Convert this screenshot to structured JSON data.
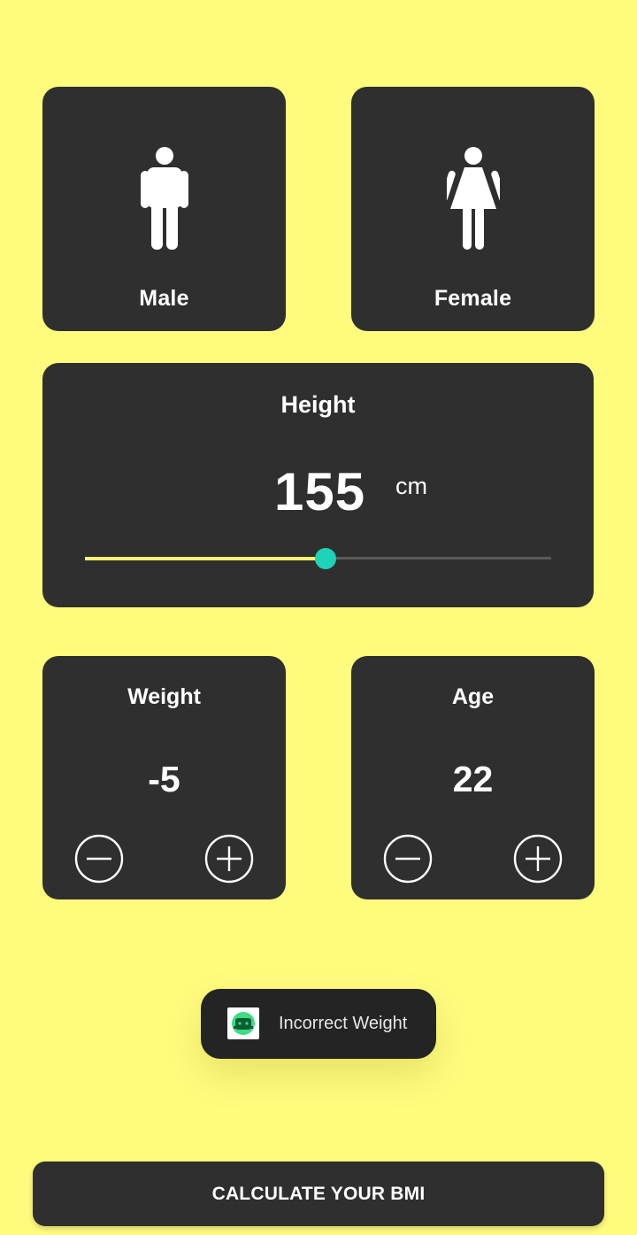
{
  "colors": {
    "background": "#FFFB7D",
    "card": "#2F2F2F",
    "slider_active": "#FFF176",
    "slider_thumb": "#1DD3B9",
    "slider_inactive": "#5A5A5A",
    "toast_bg": "#242424"
  },
  "gender": {
    "male": {
      "label": "Male",
      "icon": "male-icon"
    },
    "female": {
      "label": "Female",
      "icon": "female-icon"
    }
  },
  "height": {
    "title": "Height",
    "value": "155",
    "unit": "cm",
    "slider_fraction": 0.517
  },
  "weight": {
    "title": "Weight",
    "value": "-5",
    "minus_icon": "minus-circle-icon",
    "plus_icon": "plus-circle-icon"
  },
  "age": {
    "title": "Age",
    "value": "22",
    "minus_icon": "minus-circle-icon",
    "plus_icon": "plus-circle-icon"
  },
  "toast": {
    "icon": "android-app-icon",
    "text": "Incorrect Weight"
  },
  "calculate_button": {
    "label": "CALCULATE YOUR BMI"
  }
}
